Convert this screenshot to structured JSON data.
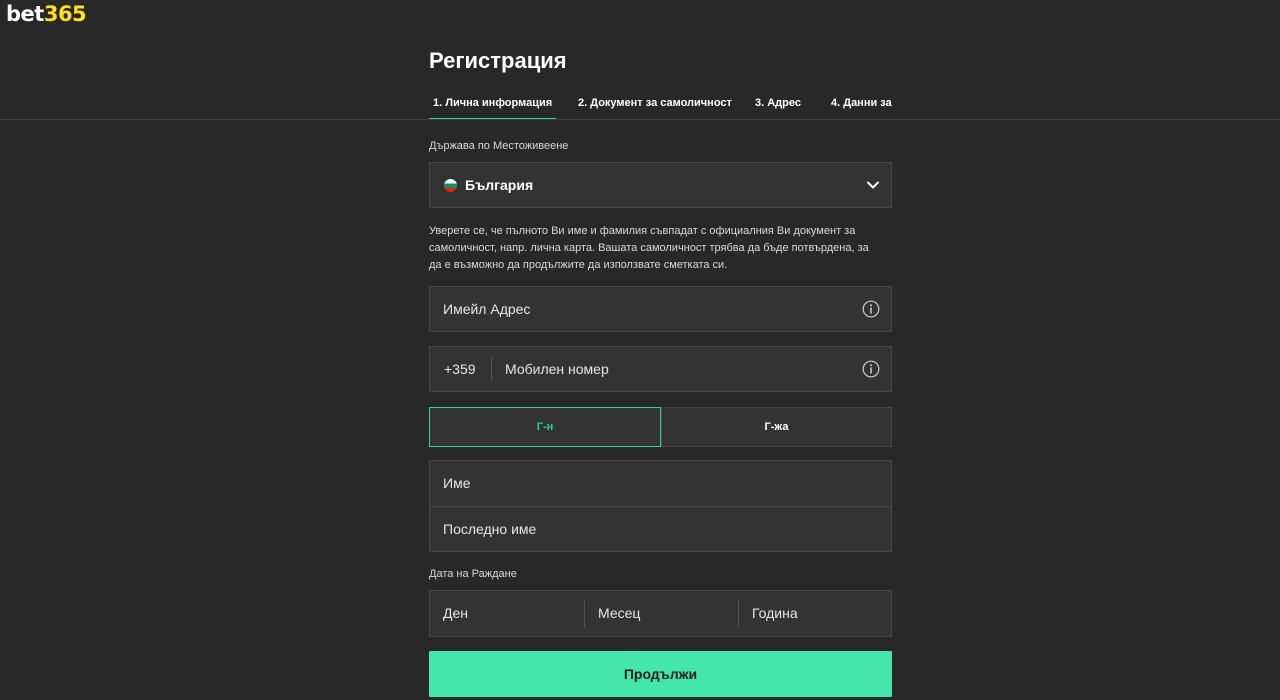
{
  "brand": {
    "logo_part1": "bet",
    "logo_part2": "365"
  },
  "page": {
    "title": "Регистрация"
  },
  "steps": [
    {
      "label": "1. Лична информация",
      "active": true
    },
    {
      "label": "2. Документ за самоличност",
      "active": false
    },
    {
      "label": "3. Адрес",
      "active": false
    },
    {
      "label": "4. Данни за",
      "active": false
    }
  ],
  "form": {
    "country_label": "Държава по Местоживеене",
    "country_value": "България",
    "notice": "Уверете се, че пълното Ви име и фамилия съвпадат с официалния Ви документ за самоличност, напр. лична карта. Вашата самоличност трябва да бъде потвърдена, за да е възможно да продължите да използвате сметката си.",
    "email_placeholder": "Имейл Адрес",
    "phone_prefix": "+359",
    "phone_placeholder": "Мобилен номер",
    "gender_options": [
      "Г-н",
      "Г-жа"
    ],
    "selected_gender": "Г-н",
    "first_name_placeholder": "Име",
    "last_name_placeholder": "Последно име",
    "dob_label": "Дата на Раждане",
    "dob_day": "Ден",
    "dob_month": "Месец",
    "dob_year": "Година",
    "continue_label": "Продължи"
  },
  "icons": {
    "flag": "bulgaria-flag-icon",
    "dropdown": "chevron-down-icon",
    "info": "info-icon"
  },
  "colors": {
    "accent": "#26d99a",
    "button": "#45e6ab",
    "background": "#282828",
    "field": "#333333",
    "logo_yellow": "#ffdf1b"
  }
}
